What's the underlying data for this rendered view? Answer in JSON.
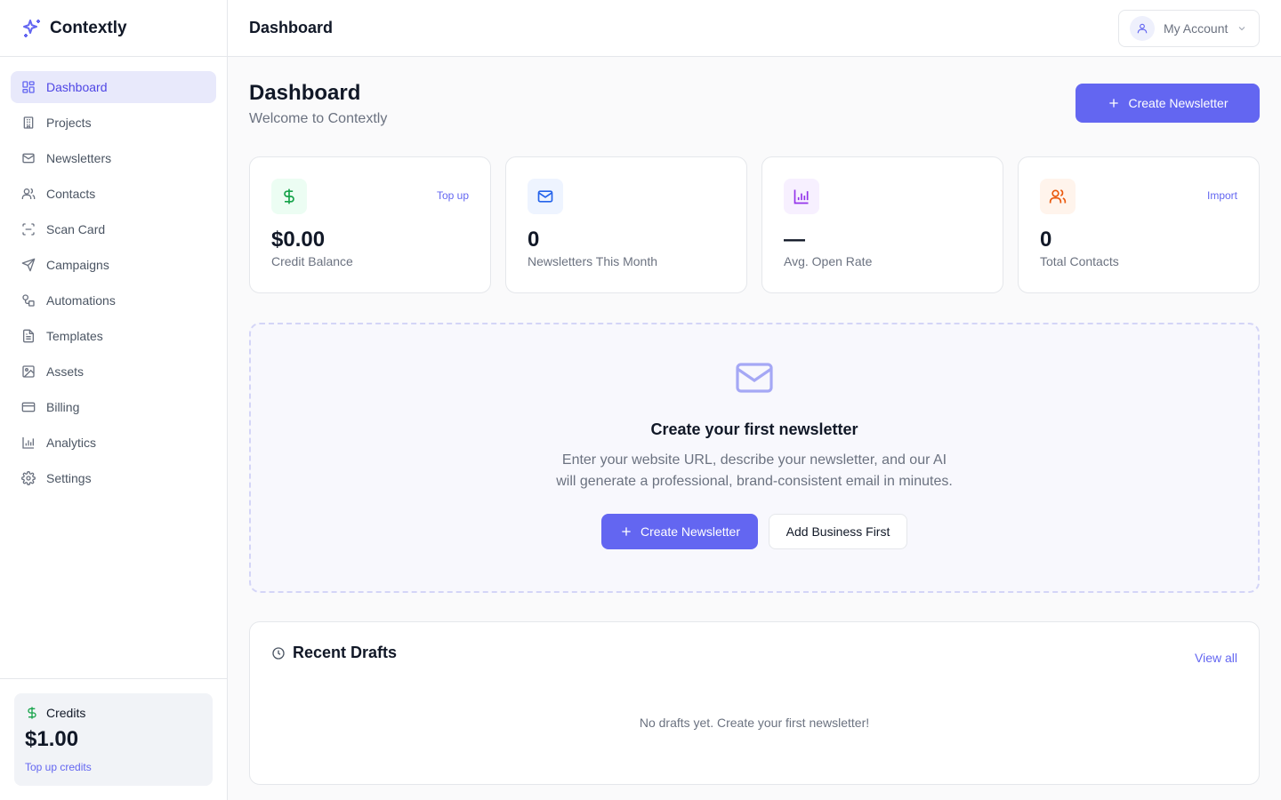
{
  "brand": {
    "name": "Contextly"
  },
  "sidebar": {
    "items": [
      {
        "label": "Dashboard",
        "icon": "dashboard-icon",
        "active": true
      },
      {
        "label": "Projects",
        "icon": "building-icon"
      },
      {
        "label": "Newsletters",
        "icon": "mail-icon"
      },
      {
        "label": "Contacts",
        "icon": "users-icon"
      },
      {
        "label": "Scan Card",
        "icon": "scan-icon"
      },
      {
        "label": "Campaigns",
        "icon": "send-icon"
      },
      {
        "label": "Automations",
        "icon": "workflow-icon"
      },
      {
        "label": "Templates",
        "icon": "file-text-icon"
      },
      {
        "label": "Assets",
        "icon": "image-icon"
      },
      {
        "label": "Billing",
        "icon": "credit-card-icon"
      },
      {
        "label": "Analytics",
        "icon": "bar-chart-icon"
      },
      {
        "label": "Settings",
        "icon": "gear-icon"
      }
    ],
    "credits": {
      "label": "Credits",
      "amount": "$1.00",
      "link": "Top up credits"
    }
  },
  "topbar": {
    "title": "Dashboard",
    "account_label": "My Account"
  },
  "page": {
    "title": "Dashboard",
    "subtitle": "Welcome to Contextly",
    "create_button": "Create Newsletter"
  },
  "stats": [
    {
      "value": "$0.00",
      "label": "Credit Balance",
      "link": "Top up",
      "icon": "dollar-icon",
      "color": "#16a34a",
      "bg": "#ecfdf3"
    },
    {
      "value": "0",
      "label": "Newsletters This Month",
      "link": "",
      "icon": "mail-icon",
      "color": "#2563eb",
      "bg": "#eef4ff"
    },
    {
      "value": "—",
      "label": "Avg. Open Rate",
      "link": "",
      "icon": "bar-chart-icon",
      "color": "#9333ea",
      "bg": "#f7f0ff"
    },
    {
      "value": "0",
      "label": "Total Contacts",
      "link": "Import",
      "icon": "users-icon",
      "color": "#ea580c",
      "bg": "#fff4ec"
    }
  ],
  "empty_state": {
    "title": "Create your first newsletter",
    "text": "Enter your website URL, describe your newsletter, and our AI will generate a professional, brand-consistent email in minutes.",
    "primary_button": "Create Newsletter",
    "secondary_button": "Add Business First"
  },
  "drafts": {
    "title": "Recent Drafts",
    "view_all": "View all",
    "empty_text": "No drafts yet. Create your first newsletter!"
  },
  "colors": {
    "accent": "#6366f1",
    "active_bg": "#e8e9fb"
  }
}
